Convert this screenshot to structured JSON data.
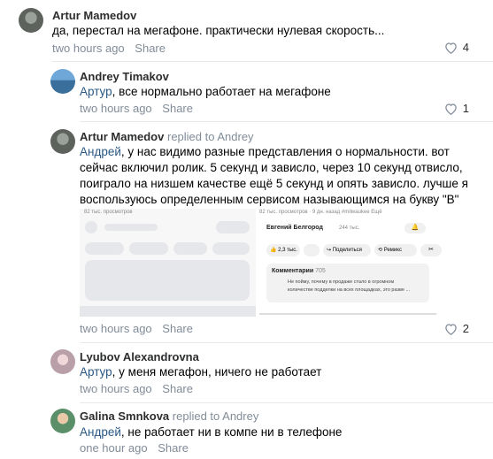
{
  "comments": [
    {
      "author": "Artur Mamedov",
      "replied_to": "",
      "mention": "",
      "text": "да, перестал на мегафоне. практически нулевая скорость...",
      "time": "two hours ago",
      "share": "Share",
      "likes": "4"
    },
    {
      "author": "Andrey Timakov",
      "replied_to": "",
      "mention": "Артур",
      "text": ", все нормально работает на мегафоне",
      "time": "two hours ago",
      "share": "Share",
      "likes": "1"
    },
    {
      "author": "Artur Mamedov",
      "replied_to": "replied to Andrey",
      "mention": "Андрей",
      "text": ", у нас видимо разные представления о нормальности. вот сейчас включил ролик. 5 секунд и зависло, через 10 секунд отвисло, поиграло на низшем качестве ещё 5 секунд и опять зависло. лучше я воспользуюсь определенным сервисом называющимся на букву \"В\"",
      "time": "two hours ago",
      "share": "Share",
      "likes": "2"
    },
    {
      "author": "Lyubov Alexandrovna",
      "replied_to": "",
      "mention": "Артур",
      "text": ", у меня мегафон, ничего не работает",
      "time": "two hours ago",
      "share": "Share",
      "likes": ""
    },
    {
      "author": "Galina Smnkova",
      "replied_to": "replied to Andrey",
      "mention": "Андрей",
      "text": ", не работает ни в компе ни в телефоне",
      "time": "one hour ago",
      "share": "Share",
      "likes": ""
    }
  ],
  "attachment": {
    "views_left": "82 тыс. просмотров",
    "views_right": "82 тыс. просмотров · 9 дн. назад #milwaukee Ещё",
    "channel": "Евгений Белгород",
    "subs": "244 тыс.",
    "like_count": "2,3 тыс.",
    "share_label": "Поделиться",
    "remix_label": "Ремикс",
    "comments_label": "Комментарии",
    "comments_count": "705",
    "comment_text": "Не пойму, почему в продаже стало в огромном количестве подделки на всех площадках, это разве ..."
  },
  "colors": {
    "mention": "#2a5885",
    "meta": "#818c99",
    "divider": "#e7e8ec"
  }
}
